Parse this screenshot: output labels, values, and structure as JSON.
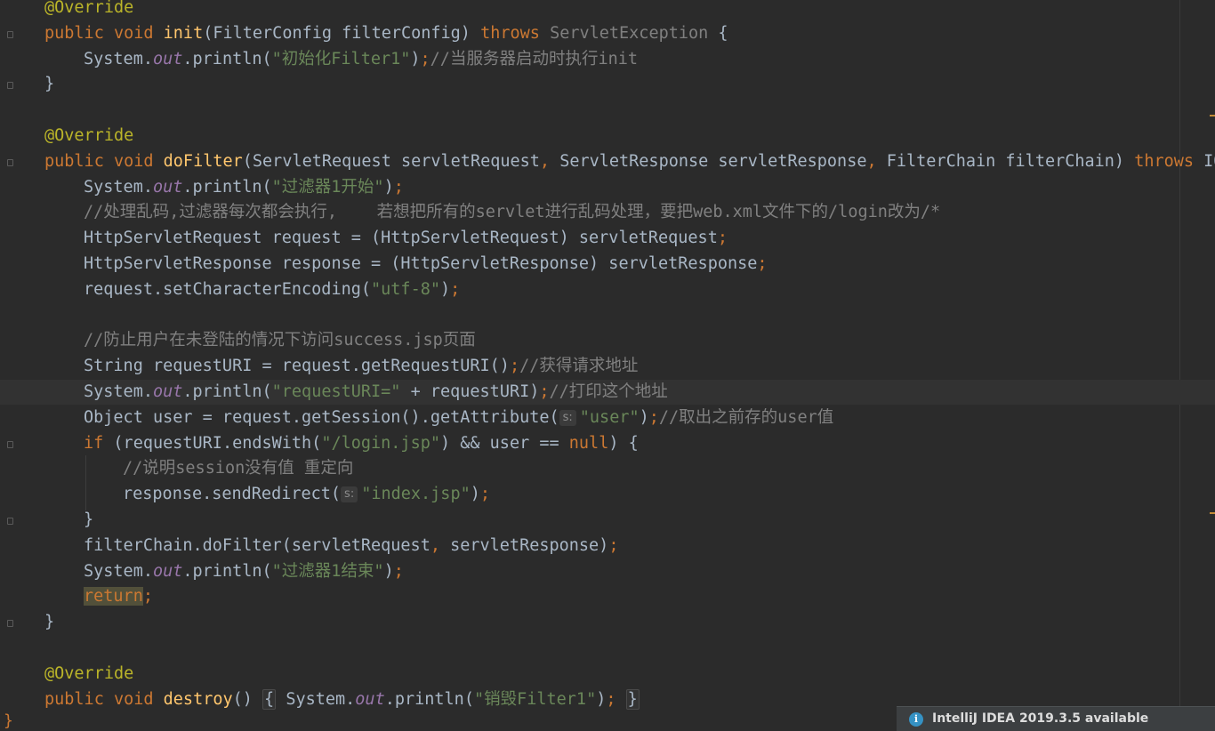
{
  "editor": {
    "lines": [
      {
        "indent": 1,
        "tokens": [
          [
            "ann",
            "@Override"
          ]
        ]
      },
      {
        "indent": 1,
        "tokens": [
          [
            "kw",
            "public void "
          ],
          [
            "fn",
            "init"
          ],
          [
            "",
            "(FilterConfig filterConfig) "
          ],
          [
            "kw",
            "throws "
          ],
          [
            "gray",
            "ServletException "
          ],
          [
            "",
            "{"
          ]
        ]
      },
      {
        "indent": 2,
        "tokens": [
          [
            "",
            "System."
          ],
          [
            "fld",
            "out"
          ],
          [
            "",
            ".println("
          ],
          [
            "str",
            "\"初始化Filter1\""
          ],
          [
            "",
            ")"
          ],
          [
            "kw",
            ";"
          ],
          [
            "cmt",
            "//当服务器启动时执行init"
          ]
        ]
      },
      {
        "indent": 1,
        "tokens": [
          [
            "",
            "}"
          ]
        ]
      },
      {
        "indent": 0,
        "tokens": []
      },
      {
        "indent": 1,
        "tokens": [
          [
            "ann",
            "@Override"
          ]
        ]
      },
      {
        "indent": 1,
        "tokens": [
          [
            "kw",
            "public void "
          ],
          [
            "fn",
            "doFilter"
          ],
          [
            "",
            "(ServletRequest servletRequest"
          ],
          [
            "kw",
            ", "
          ],
          [
            "",
            "ServletResponse servletResponse"
          ],
          [
            "kw",
            ", "
          ],
          [
            "",
            "FilterChain filterChain) "
          ],
          [
            "kw",
            "throws "
          ],
          [
            "",
            "IOE"
          ]
        ]
      },
      {
        "indent": 2,
        "tokens": [
          [
            "",
            "System."
          ],
          [
            "fld",
            "out"
          ],
          [
            "",
            ".println("
          ],
          [
            "str",
            "\"过滤器1开始\""
          ],
          [
            "",
            ")"
          ],
          [
            "kw",
            ";"
          ]
        ]
      },
      {
        "indent": 2,
        "tokens": [
          [
            "cmt",
            "//处理乱码,过滤器每次都会执行,    若想把所有的servlet进行乱码处理，要把web.xml文件下的/login改为/*"
          ]
        ]
      },
      {
        "indent": 2,
        "tokens": [
          [
            "",
            "HttpServletRequest request = (HttpServletRequest) servletRequest"
          ],
          [
            "kw",
            ";"
          ]
        ]
      },
      {
        "indent": 2,
        "tokens": [
          [
            "",
            "HttpServletResponse response = (HttpServletResponse) servletResponse"
          ],
          [
            "kw",
            ";"
          ]
        ]
      },
      {
        "indent": 2,
        "tokens": [
          [
            "",
            "request.setCharacterEncoding("
          ],
          [
            "str",
            "\"utf-8\""
          ],
          [
            "",
            ")"
          ],
          [
            "kw",
            ";"
          ]
        ]
      },
      {
        "indent": 0,
        "tokens": []
      },
      {
        "indent": 2,
        "tokens": [
          [
            "cmt",
            "//防止用户在未登陆的情况下访问success.jsp页面"
          ]
        ]
      },
      {
        "indent": 2,
        "tokens": [
          [
            "",
            "String requestURI = request.getRequestURI()"
          ],
          [
            "kw",
            ";"
          ],
          [
            "cmt",
            "//获得请求地址"
          ]
        ]
      },
      {
        "indent": 2,
        "current": true,
        "tokens": [
          [
            "",
            "System."
          ],
          [
            "fld",
            "out"
          ],
          [
            "",
            ".println("
          ],
          [
            "str",
            "\"requestURI=\""
          ],
          [
            "",
            " + requestURI)"
          ],
          [
            "kw",
            ";"
          ],
          [
            "cmt",
            "//打印这个地址"
          ]
        ]
      },
      {
        "indent": 2,
        "tokens": [
          [
            "",
            "Object user = request.getSession().getAttribute("
          ],
          [
            "hint",
            "s:"
          ],
          [
            "str",
            "\"user\""
          ],
          [
            "",
            ")"
          ],
          [
            "kw",
            ";"
          ],
          [
            "cmt",
            "//取出之前存的user值"
          ]
        ]
      },
      {
        "indent": 2,
        "tokens": [
          [
            "kw",
            "if "
          ],
          [
            "",
            "(requestURI.endsWith("
          ],
          [
            "str",
            "\"/login.jsp\""
          ],
          [
            "",
            ") && user == "
          ],
          [
            "kw",
            "null"
          ],
          [
            "",
            ") {"
          ]
        ]
      },
      {
        "indent": 3,
        "tokens": [
          [
            "cmt",
            "//说明session没有值 重定向"
          ]
        ]
      },
      {
        "indent": 3,
        "tokens": [
          [
            "",
            "response.sendRedirect("
          ],
          [
            "hint",
            "s:"
          ],
          [
            "str",
            "\"index.jsp\""
          ],
          [
            "",
            ")"
          ],
          [
            "kw",
            ";"
          ]
        ]
      },
      {
        "indent": 2,
        "tokens": [
          [
            "",
            "}"
          ]
        ]
      },
      {
        "indent": 2,
        "tokens": [
          [
            "",
            "filterChain.doFilter(servletRequest"
          ],
          [
            "kw",
            ", "
          ],
          [
            "",
            "servletResponse)"
          ],
          [
            "kw",
            ";"
          ]
        ]
      },
      {
        "indent": 2,
        "tokens": [
          [
            "",
            "System."
          ],
          [
            "fld",
            "out"
          ],
          [
            "",
            ".println("
          ],
          [
            "str",
            "\"过滤器1结束\""
          ],
          [
            "",
            ")"
          ],
          [
            "kw",
            ";"
          ]
        ]
      },
      {
        "indent": 2,
        "tokens": [
          [
            "ret",
            "return"
          ],
          [
            "kw",
            ";"
          ]
        ]
      },
      {
        "indent": 1,
        "tokens": [
          [
            "",
            "}"
          ]
        ]
      },
      {
        "indent": 0,
        "tokens": []
      },
      {
        "indent": 1,
        "tokens": [
          [
            "ann",
            "@Override"
          ]
        ]
      },
      {
        "indent": 1,
        "tokens": [
          [
            "kw",
            "public void "
          ],
          [
            "fn",
            "destroy"
          ],
          [
            "",
            "() "
          ],
          [
            "fbox",
            "{"
          ],
          [
            "",
            " System."
          ],
          [
            "fld",
            "out"
          ],
          [
            "",
            ".println("
          ],
          [
            "str",
            "\"销毁Filter1\""
          ],
          [
            "",
            ")"
          ],
          [
            "kw",
            ";"
          ],
          [
            "",
            " "
          ],
          [
            "fbox",
            "}"
          ]
        ]
      }
    ]
  },
  "notification": {
    "icon": "info-icon",
    "text": "IntelliJ IDEA 2019.3.5 available"
  }
}
